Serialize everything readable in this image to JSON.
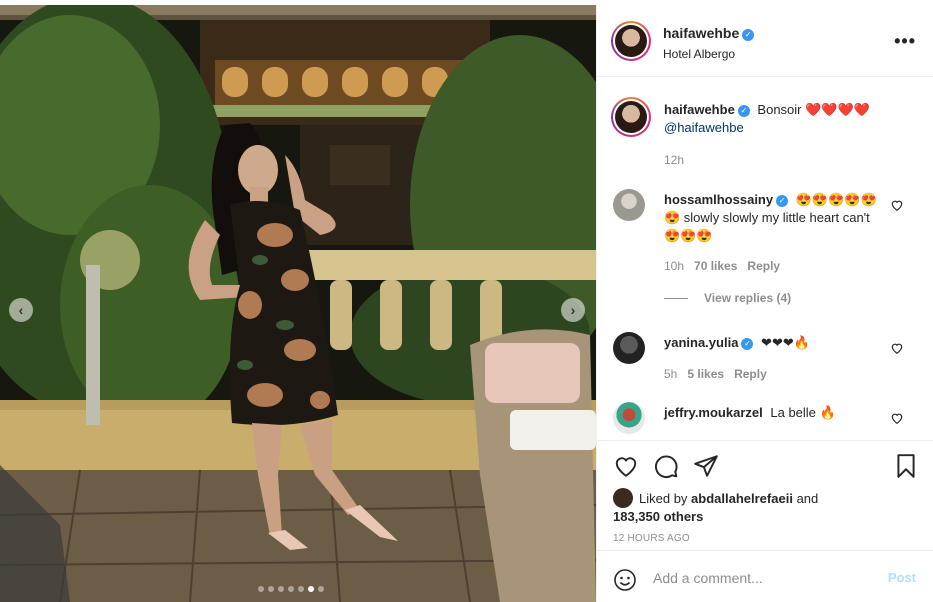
{
  "post": {
    "username": "haifawehbe",
    "location": "Hotel Albergo",
    "more_label": "•••",
    "image_alt": "woman in floral dress on terrace at night",
    "carousel": {
      "total": 7,
      "active_index": 5
    }
  },
  "caption": {
    "username": "haifawehbe",
    "text": "Bonsoir ❤️❤️❤️❤️",
    "mention": "@haifawehbe",
    "time": "12h"
  },
  "comments": [
    {
      "username": "hossamlhossainy",
      "verified": true,
      "text": "😍😍😍😍😍😍 slowly slowly my little heart can't 😍😍😍",
      "time": "10h",
      "likes": "70 likes",
      "reply": "Reply",
      "view_replies": "View replies (4)"
    },
    {
      "username": "yanina.yulia",
      "verified": true,
      "text": "❤❤❤🔥",
      "time": "5h",
      "likes": "5 likes",
      "reply": "Reply"
    },
    {
      "username": "jeffry.moukarzel",
      "verified": false,
      "text": "La belle 🔥"
    }
  ],
  "likes": {
    "prefix": "Liked by",
    "user": "abdallahelrefaeii",
    "joiner": "and",
    "count": "183,350 others"
  },
  "timestamp": "12 HOURS AGO",
  "add_comment": {
    "placeholder": "Add a comment...",
    "post_label": "Post"
  },
  "colors": {
    "verified": "#3897f0",
    "post_disabled": "#b2dffc",
    "meta": "#8e8e8e",
    "border": "#efefef"
  },
  "icons": [
    "chevron-left-icon",
    "chevron-right-icon",
    "more-icon",
    "heart-icon",
    "comment-icon",
    "share-icon",
    "bookmark-icon",
    "emoji-icon",
    "verified-icon"
  ]
}
